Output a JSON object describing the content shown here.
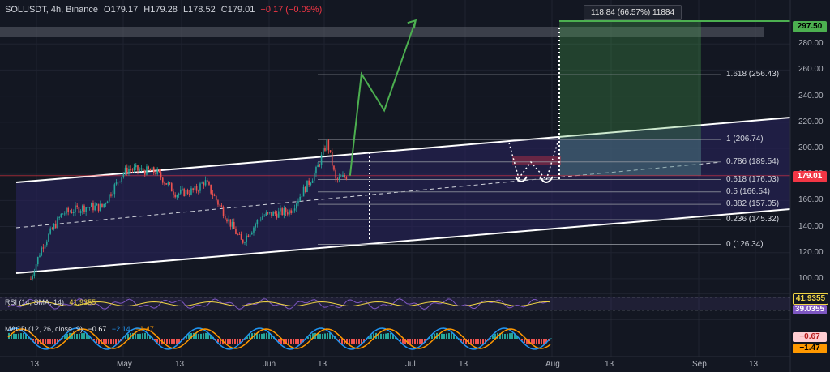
{
  "header": {
    "symbol": "SOLUSDT, 4h, Binance",
    "open": "O179.17",
    "high": "H179.28",
    "low": "L178.52",
    "close": "C179.01",
    "change": "−0.17 (−0.09%)"
  },
  "measure_label": "118.84 (66.57%) 11884",
  "price_axis": {
    "ticks": [
      "280.00",
      "260.00",
      "240.00",
      "220.00",
      "200.00",
      "180.00",
      "160.00",
      "140.00",
      "120.00",
      "100.00"
    ],
    "current_price": "179.01",
    "target_price": "297.50"
  },
  "time_axis": {
    "ticks": [
      "13",
      "May",
      "13",
      "Jun",
      "13",
      "Jul",
      "13",
      "Aug",
      "13",
      "Sep",
      "13"
    ]
  },
  "fib_levels": [
    {
      "label": "1.618 (256.43)"
    },
    {
      "label": "1 (206.74)"
    },
    {
      "label": "0.786 (189.54)"
    },
    {
      "label": "0.618 (176.03)"
    },
    {
      "label": "0.5 (166.54)"
    },
    {
      "label": "0.382 (157.05)"
    },
    {
      "label": "0.236 (145.32)"
    },
    {
      "label": "0 (126.34)"
    }
  ],
  "rsi": {
    "label": "RSI (14, SMA, 14)",
    "value": "41.9355",
    "tag1": "41.9355",
    "tag2": "39.0355"
  },
  "macd": {
    "label": "MACD (12, 26, close, 9)",
    "v1": "−0.67",
    "v2": "−2.14",
    "v3": "−1.47",
    "tag1": "−0.67",
    "tag2": "−1.47"
  },
  "colors": {
    "bg": "#131722",
    "up": "#26a69a",
    "down": "#ef5350",
    "channel": "#2a2460",
    "target": "#4caf50",
    "accent": "#f23645"
  },
  "chart_data": {
    "type": "candlestick",
    "title": "SOLUSDT, 4h, Binance",
    "ylim": [
      90,
      300
    ],
    "x_ticks": [
      "13",
      "May",
      "13",
      "Jun",
      "13",
      "Jul",
      "13",
      "Aug",
      "13",
      "Sep",
      "13"
    ],
    "y_ticks": [
      100,
      120,
      140,
      160,
      180,
      200,
      220,
      240,
      260,
      280
    ],
    "price_path": [
      {
        "x": "Apr 11",
        "y": 100
      },
      {
        "x": "Apr 15",
        "y": 125
      },
      {
        "x": "Apr 22",
        "y": 150
      },
      {
        "x": "Apr 30",
        "y": 155
      },
      {
        "x": "May 6",
        "y": 155
      },
      {
        "x": "May 13",
        "y": 180
      },
      {
        "x": "May 15",
        "y": 184
      },
      {
        "x": "May 25",
        "y": 182
      },
      {
        "x": "Jun 1",
        "y": 165
      },
      {
        "x": "Jun 8",
        "y": 168
      },
      {
        "x": "Jun 11",
        "y": 175
      },
      {
        "x": "Jun 24",
        "y": 128
      },
      {
        "x": "Jul 1",
        "y": 148
      },
      {
        "x": "Jul 11",
        "y": 152
      },
      {
        "x": "Jul 20",
        "y": 182
      },
      {
        "x": "Jul 24",
        "y": 205
      },
      {
        "x": "Jul 27",
        "y": 175
      },
      {
        "x": "Jul 31",
        "y": 179
      }
    ],
    "projection": [
      {
        "x": "Aug 1",
        "y": 179
      },
      {
        "x": "Aug 5",
        "y": 257
      },
      {
        "x": "Aug 13",
        "y": 229
      },
      {
        "x": "Aug 24",
        "y": 298
      }
    ],
    "target": 297.5,
    "measure": {
      "change": 118.84,
      "percent": 66.57,
      "ticks": 11884
    }
  }
}
